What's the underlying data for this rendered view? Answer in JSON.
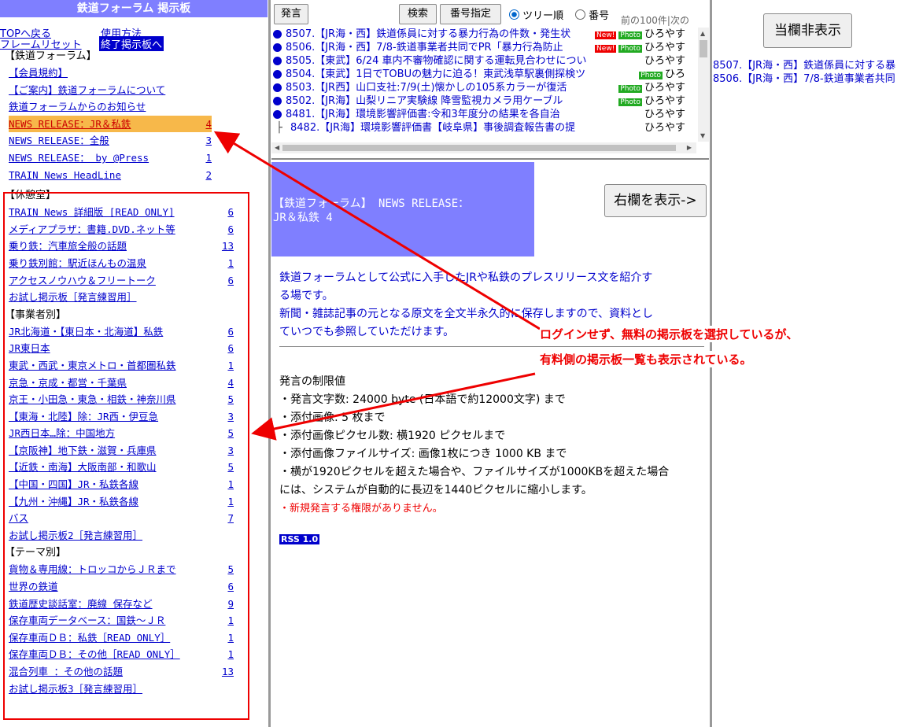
{
  "left": {
    "title": "鉄道フォーラム 掲示板",
    "links": {
      "top": "TOPへ戻る",
      "howto": "使用方法",
      "reset": "フレームリセット",
      "exit": "終了掲示板へ"
    },
    "forum_heading": "【鉄道フォーラム】",
    "forum_items": [
      {
        "name": "【会員規約】",
        "count": ""
      },
      {
        "name": "【ご案内】鉄道フォーラムについて",
        "count": ""
      },
      {
        "name": "鉄道フォーラムからのお知らせ",
        "count": ""
      },
      {
        "name": "NEWS RELEASE：JR＆私鉄",
        "count": "4"
      },
      {
        "name": "NEWS RELEASE：全般",
        "count": "3"
      },
      {
        "name": "NEWS RELEASE： by @Press",
        "count": "1"
      },
      {
        "name": "TRAIN News HeadLine",
        "count": "2"
      }
    ],
    "rest_heading": "【休憩室】",
    "rest_items": [
      {
        "name": "TRAIN News 詳細版 [READ ONLY]",
        "count": "6"
      },
      {
        "name": "メディアプラザ：書籍.DVD.ネット等",
        "count": "6"
      },
      {
        "name": "乗り鉄：汽車旅全般の話題",
        "count": "13"
      },
      {
        "name": "乗り鉄別館：駅近ほんもの温泉",
        "count": "1"
      },
      {
        "name": "アクセスノウハウ＆フリートーク",
        "count": "6"
      },
      {
        "name": "お試し掲示板［発言練習用］",
        "count": ""
      }
    ],
    "biz_heading": "【事業者別】",
    "biz_items": [
      {
        "name": "JR北海道・【東日本・北海道】私鉄",
        "count": "6"
      },
      {
        "name": "JR東日本",
        "count": "6"
      },
      {
        "name": "東武・西武・東京メトロ・首都圏私鉄",
        "count": "1"
      },
      {
        "name": "京急・京成・都営・千葉県",
        "count": "4"
      },
      {
        "name": "京王・小田急・東急・相鉄・神奈川県",
        "count": "5"
      },
      {
        "name": "【東海・北陸】除：JR西・伊豆急",
        "count": "3"
      },
      {
        "name": "JR西日本…除：中国地方",
        "count": "5"
      },
      {
        "name": "【京阪神】地下鉄・滋賀・兵庫県",
        "count": "3"
      },
      {
        "name": "【近鉄・南海】大阪南部・和歌山",
        "count": "5"
      },
      {
        "name": "【中国・四国】JR・私鉄各線",
        "count": "1"
      },
      {
        "name": "【九州・沖縄】JR・私鉄各線",
        "count": "1"
      },
      {
        "name": "バス",
        "count": "7"
      },
      {
        "name": "お試し掲示板2［発言練習用］",
        "count": ""
      }
    ],
    "theme_heading": "【テーマ別】",
    "theme_items": [
      {
        "name": "貨物＆専用線：トロッコからＪＲまで",
        "count": "5"
      },
      {
        "name": "世界の鉄道",
        "count": "6"
      },
      {
        "name": "鉄道歴史談話室：廃線 保存など",
        "count": "9"
      },
      {
        "name": "保存車両データベース：国鉄～ＪＲ",
        "count": "1"
      },
      {
        "name": "保存車両ＤＢ：私鉄［READ ONLY］",
        "count": "1"
      },
      {
        "name": "保存車両ＤＢ：その他［READ ONLY］",
        "count": "1"
      },
      {
        "name": "混合列車 ：その他の話題",
        "count": "13"
      },
      {
        "name": "お試し掲示板3［発言練習用］",
        "count": ""
      }
    ]
  },
  "toolbar": {
    "post": "発言",
    "search": "検索",
    "number": "番号指定",
    "tree": "ツリー順",
    "num_order": "番号",
    "nav": "前の100件|次の"
  },
  "posts": [
    {
      "text": "8507.【JR海・西】鉄道係員に対する暴力行為の件数・発生状",
      "new": "New!",
      "photo": "Photo",
      "author": "ひろやす",
      "dot": true
    },
    {
      "text": "8506.【JR海・西】7/8-鉄道事業者共同でPR「暴力行為防止",
      "new": "New!",
      "photo": "Photo",
      "author": "ひろやす",
      "dot": true
    },
    {
      "text": "8505.【東武】6/24 車内不審物確認に関する運転見合わせについ",
      "new": "",
      "photo": "",
      "author": "ひろやす",
      "dot": true
    },
    {
      "text": "8504.【東武】1日でTOBUの魅力に迫る！東武浅草駅裏側探検ツ",
      "new": "",
      "photo": "Photo",
      "author": "ひろ",
      "dot": true
    },
    {
      "text": "8503.【JR西】山口支社:7/9(土)懐かしの105系カラーが復活",
      "new": "",
      "photo": "Photo",
      "author": "ひろやす",
      "dot": true
    },
    {
      "text": "8502.【JR海】山梨リニア実験線 降雪監視カメラ用ケーブル",
      "new": "",
      "photo": "Photo",
      "author": "ひろやす",
      "dot": true
    },
    {
      "text": "8481.【JR海】環境影響評価書:令和3年度分の結果を各自治",
      "new": "",
      "photo": "",
      "author": "ひろやす",
      "dot": true
    },
    {
      "text": "8482.【JR海】環境影響評価書【岐阜県】事後調査報告書の提",
      "new": "",
      "photo": "",
      "author": "ひろやす",
      "dot": false
    }
  ],
  "banner": {
    "line1": "【鉄道フォーラム】 NEWS RELEASE：",
    "line2": "JR＆私鉄 4"
  },
  "show_right": "右欄を表示->",
  "description": [
    "鉄道フォーラムとして公式に入手したJRや私鉄のプレスリリース文を紹介す",
    "る場です。",
    "新聞・雑誌記事の元となる原文を全文半永久的に保存しますので、資料とし",
    "ていつでも参照していただけます。"
  ],
  "limits": {
    "title": "発言の制限値",
    "lines": [
      "・発言文字数: 24000 byte (日本語で約12000文字) まで",
      "・添付画像: 5 枚まで",
      "・添付画像ピクセル数: 横1920 ピクセルまで",
      "・添付画像ファイルサイズ: 画像1枚につき 1000 KB まで",
      "・横が1920ピクセルを超えた場合や、ファイルサイズが1000KBを超えた場合",
      "には、システムが自動的に長辺を1440ピクセルに縮小します。"
    ],
    "warning": "・新規発言する権限がありません。"
  },
  "rss": "RSS 1.0",
  "right": {
    "hide": "当欄非表示",
    "links": [
      "8507.【JR海・西】鉄道係員に対する暴",
      "8506.【JR海・西】7/8-鉄道事業者共同"
    ]
  },
  "annotation": {
    "line1": "ログインせず、無料の掲示板を選択しているが、",
    "line2": "有料側の掲示板一覧も表示されている。"
  },
  "colors": {
    "accent": "#7f7fff",
    "link": "#0000cc",
    "annotation": "#ee0000",
    "selected": "#f7b84a"
  }
}
